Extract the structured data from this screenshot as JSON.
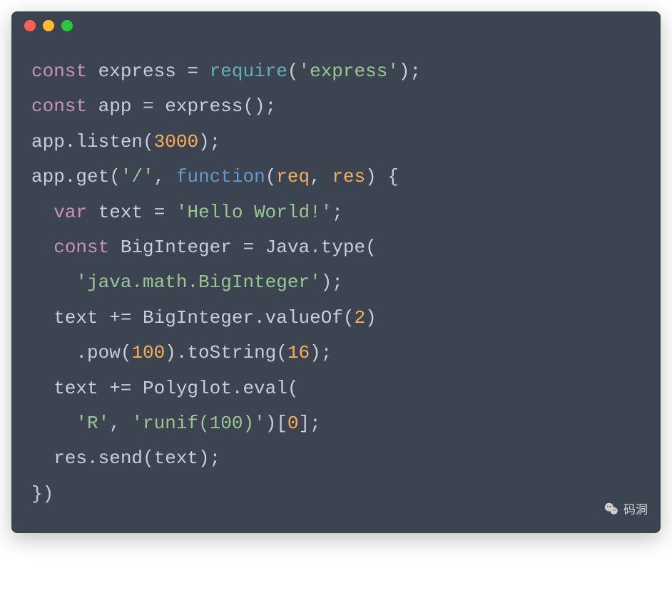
{
  "code": {
    "lines": [
      {
        "tokens": [
          {
            "t": "const",
            "c": "keyword"
          },
          {
            "t": " express = ",
            "c": "plain"
          },
          {
            "t": "require",
            "c": "builtin"
          },
          {
            "t": "(",
            "c": "plain"
          },
          {
            "t": "'express'",
            "c": "string"
          },
          {
            "t": ");",
            "c": "plain"
          }
        ]
      },
      {
        "tokens": [
          {
            "t": "const",
            "c": "keyword"
          },
          {
            "t": " app = express();",
            "c": "plain"
          }
        ]
      },
      {
        "tokens": [
          {
            "t": "app.listen(",
            "c": "plain"
          },
          {
            "t": "3000",
            "c": "number"
          },
          {
            "t": ");",
            "c": "plain"
          }
        ]
      },
      {
        "tokens": [
          {
            "t": "app.get(",
            "c": "plain"
          },
          {
            "t": "'/'",
            "c": "string"
          },
          {
            "t": ", ",
            "c": "plain"
          },
          {
            "t": "function",
            "c": "funcname"
          },
          {
            "t": "(",
            "c": "plain"
          },
          {
            "t": "req",
            "c": "param"
          },
          {
            "t": ", ",
            "c": "plain"
          },
          {
            "t": "res",
            "c": "param"
          },
          {
            "t": ") {",
            "c": "plain"
          }
        ]
      },
      {
        "tokens": [
          {
            "t": "  ",
            "c": "plain"
          },
          {
            "t": "var",
            "c": "keyword"
          },
          {
            "t": " text = ",
            "c": "plain"
          },
          {
            "t": "'Hello World!'",
            "c": "string"
          },
          {
            "t": ";",
            "c": "plain"
          }
        ]
      },
      {
        "tokens": [
          {
            "t": "  ",
            "c": "plain"
          },
          {
            "t": "const",
            "c": "keyword"
          },
          {
            "t": " BigInteger = Java.type(",
            "c": "plain"
          }
        ]
      },
      {
        "tokens": [
          {
            "t": "    ",
            "c": "plain"
          },
          {
            "t": "'java.math.BigInteger'",
            "c": "string"
          },
          {
            "t": ");",
            "c": "plain"
          }
        ]
      },
      {
        "tokens": [
          {
            "t": "  text += BigInteger.valueOf(",
            "c": "plain"
          },
          {
            "t": "2",
            "c": "number"
          },
          {
            "t": ")",
            "c": "plain"
          }
        ]
      },
      {
        "tokens": [
          {
            "t": "    .pow(",
            "c": "plain"
          },
          {
            "t": "100",
            "c": "number"
          },
          {
            "t": ").toString(",
            "c": "plain"
          },
          {
            "t": "16",
            "c": "number"
          },
          {
            "t": ");",
            "c": "plain"
          }
        ]
      },
      {
        "tokens": [
          {
            "t": "  text += Polyglot.eval(",
            "c": "plain"
          }
        ]
      },
      {
        "tokens": [
          {
            "t": "    ",
            "c": "plain"
          },
          {
            "t": "'R'",
            "c": "string"
          },
          {
            "t": ", ",
            "c": "plain"
          },
          {
            "t": "'runif(100)'",
            "c": "string"
          },
          {
            "t": ")[",
            "c": "plain"
          },
          {
            "t": "0",
            "c": "number"
          },
          {
            "t": "];",
            "c": "plain"
          }
        ]
      },
      {
        "tokens": [
          {
            "t": "  res.send(text);",
            "c": "plain"
          }
        ]
      },
      {
        "tokens": [
          {
            "t": "})",
            "c": "plain"
          }
        ]
      }
    ]
  },
  "watermark": {
    "text": "码洞"
  }
}
